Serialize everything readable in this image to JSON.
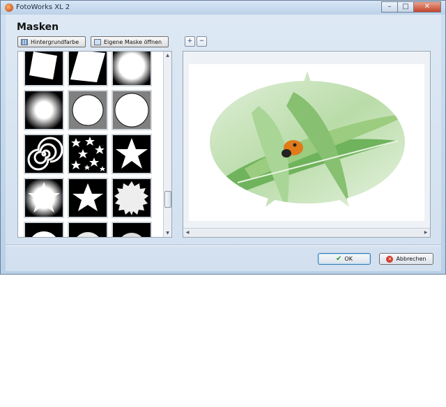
{
  "window": {
    "title": "FotoWorks XL 2",
    "minimize": "–",
    "maximize": "□",
    "close": "✕"
  },
  "dialog": {
    "heading": "Masken"
  },
  "toolbar": {
    "background_color_label": "Hintergrundfarbe",
    "open_mask_label": "Eigene Maske öffnen",
    "zoom_in": "+",
    "zoom_out": "−"
  },
  "gallery": {
    "masks": [
      "rotated-square",
      "skewed-square",
      "soft-square",
      "soft-square-large",
      "circle",
      "circle-large",
      "spiral",
      "stars-pattern",
      "star",
      "star-soft",
      "star-white",
      "seal-burst",
      "burst-1",
      "burst-2",
      "burst-3"
    ]
  },
  "scrollbar": {
    "up": "▲",
    "down": "▼",
    "left": "◀",
    "right": "▶"
  },
  "footer": {
    "ok_label": "OK",
    "ok_icon": "✔",
    "cancel_label": "Abbrechen",
    "cancel_icon": "✕"
  },
  "colors": {
    "accent": "#3c7fb1",
    "leaf_green": "#7fbf6a",
    "ladybug": "#e07a1a"
  }
}
